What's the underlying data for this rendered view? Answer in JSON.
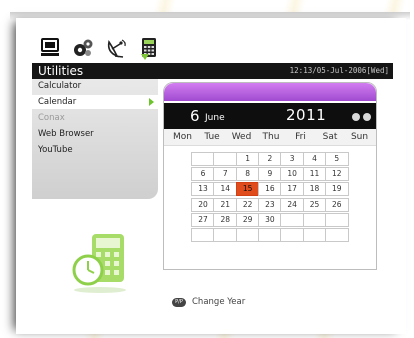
{
  "toolbar": {
    "icons": [
      "tv-icon",
      "settings-gears-icon",
      "satellite-dish-icon",
      "calculator-icon"
    ],
    "selected_icon": "calculator-icon"
  },
  "header": {
    "title": "Utilities",
    "datetime": "12:13/05-Jul-2006[Wed]"
  },
  "menu": {
    "items": [
      {
        "label": "Calculator",
        "state": "normal"
      },
      {
        "label": "Calendar",
        "state": "selected"
      },
      {
        "label": "Conax",
        "state": "disabled"
      },
      {
        "label": "Web Browser",
        "state": "normal"
      },
      {
        "label": "YouTube",
        "state": "normal"
      }
    ]
  },
  "calendar": {
    "day": "6",
    "month": "June",
    "year": "2011",
    "weekdays": [
      "Mon",
      "Tue",
      "Wed",
      "Thu",
      "Fri",
      "Sat",
      "Sun"
    ],
    "weeks": [
      [
        "",
        "",
        "1",
        "2",
        "3",
        "4",
        "5"
      ],
      [
        "6",
        "7",
        "8",
        "9",
        "10",
        "11",
        "12"
      ],
      [
        "13",
        "14",
        "15",
        "16",
        "17",
        "18",
        "19"
      ],
      [
        "20",
        "21",
        "22",
        "23",
        "24",
        "25",
        "26"
      ],
      [
        "27",
        "28",
        "29",
        "30",
        "",
        "",
        ""
      ],
      [
        "",
        "",
        "",
        "",
        "",
        "",
        ""
      ]
    ],
    "highlighted_day": "15"
  },
  "footer": {
    "hint_key": "P/P",
    "hint_label": "Change Year"
  },
  "colors": {
    "accent_green": "#7ec633",
    "today_red": "#e04c1c",
    "calendar_band_purple": "#c06be8",
    "titlebar": "#151515"
  }
}
